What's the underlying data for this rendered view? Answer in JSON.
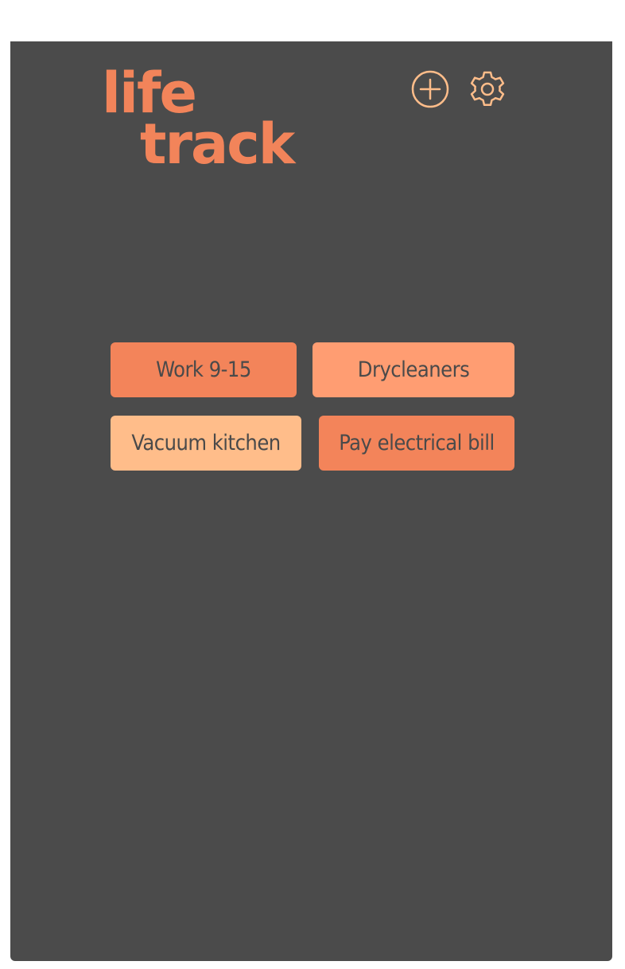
{
  "app": {
    "logo": {
      "line1": "life",
      "line2": "track"
    },
    "colors": {
      "background": "#4b4b4b",
      "accent": "#f2845a",
      "task_dark": "#f3845a",
      "task_medium": "#ff9d72",
      "task_light": "#ffbd8a"
    },
    "toolbar": {
      "add_icon": "plus-circle-icon",
      "settings_icon": "gear-icon"
    },
    "tasks": [
      {
        "label": "Work 9-15",
        "color": "#f3845a"
      },
      {
        "label": "Drycleaners",
        "color": "#ff9d72"
      },
      {
        "label": "Vacuum kitchen",
        "color": "#ffbd8a"
      },
      {
        "label": "Pay electrical bill",
        "color": "#f3845a"
      }
    ]
  }
}
